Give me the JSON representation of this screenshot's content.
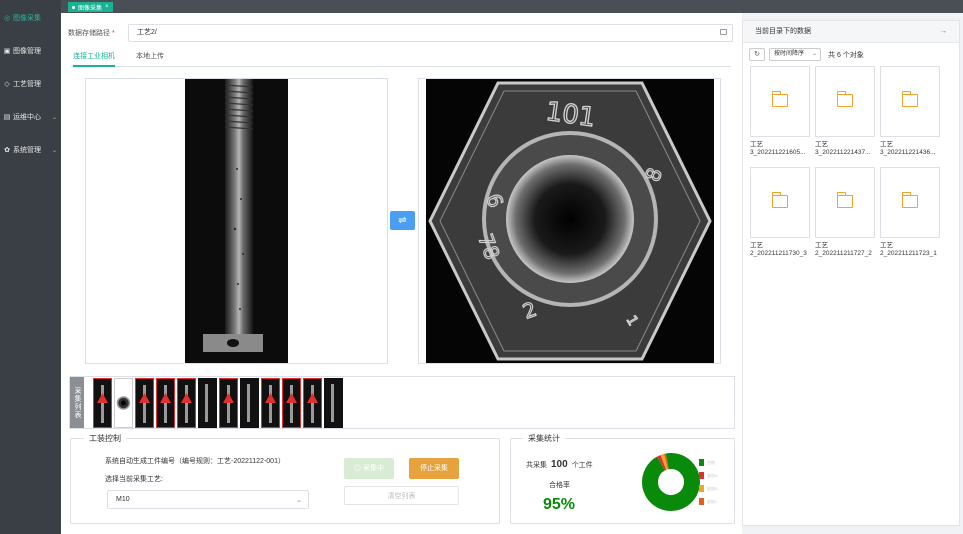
{
  "sidebar": {
    "items": [
      {
        "label": "图像采集",
        "icon": "camera-icon",
        "glyph": "◎",
        "active": true
      },
      {
        "label": "图像管理",
        "icon": "image-icon",
        "glyph": "▣"
      },
      {
        "label": "工艺管理",
        "icon": "process-icon",
        "glyph": "◇"
      },
      {
        "label": "运维中心",
        "icon": "ops-icon",
        "glyph": "▤",
        "has_children": true
      },
      {
        "label": "系统管理",
        "icon": "gear-icon",
        "glyph": "✿",
        "has_children": true
      }
    ],
    "chevron": "⌄"
  },
  "tabs": [
    {
      "label": "图像采集",
      "close": "×"
    }
  ],
  "form": {
    "path_label": "数据存储路径",
    "required_mark": "*",
    "path_value": "工艺2/"
  },
  "subtabs": [
    "连接工业相机",
    "本地上传"
  ],
  "swap_glyph": "⇌",
  "strip": {
    "label": "采集列表",
    "thumbs": [
      "red",
      "white",
      "red",
      "red",
      "red",
      "dark",
      "red",
      "dark",
      "red",
      "red",
      "red",
      "dark"
    ]
  },
  "tooling": {
    "title": "工装控制",
    "auto_text": "系统自动生成工件编号（编号规则：工艺-20221122-001）",
    "select_label": "选择当前采集工艺:",
    "select_value": "M10",
    "collecting_btn": "◎ 采集中",
    "stop_btn": "停止采集",
    "clear_btn": "清空列表"
  },
  "stats": {
    "title": "采集统计",
    "total_prefix": "共采集",
    "total_value": "100",
    "total_suffix": "个工件",
    "rate_label": "合格率",
    "rate_value": "95%",
    "donut": [
      {
        "label": "合格",
        "value": 95,
        "color": "#0a8a0a"
      },
      {
        "label": "缺陷A",
        "value": 2,
        "color": "#e03030"
      },
      {
        "label": "缺陷B",
        "value": 2,
        "color": "#f2a32a"
      },
      {
        "label": "缺陷C",
        "value": 1,
        "color": "#e06020"
      }
    ]
  },
  "right_panel": {
    "title": "当前目录下的数据",
    "arrow": "→",
    "refresh": "↻",
    "sort_label": "按时间降序",
    "count_text": "共 6 个对象",
    "folders": [
      {
        "line1": "工艺",
        "line2": "3_202211221605..."
      },
      {
        "line1": "工艺",
        "line2": "3_202211221437..."
      },
      {
        "line1": "工艺",
        "line2": "3_202211221436..."
      },
      {
        "line1": "工艺",
        "line2": "2_202211211730_3"
      },
      {
        "line1": "工艺",
        "line2": "2_202211211727_2"
      },
      {
        "line1": "工艺",
        "line2": "2_202211211723_1"
      }
    ]
  }
}
